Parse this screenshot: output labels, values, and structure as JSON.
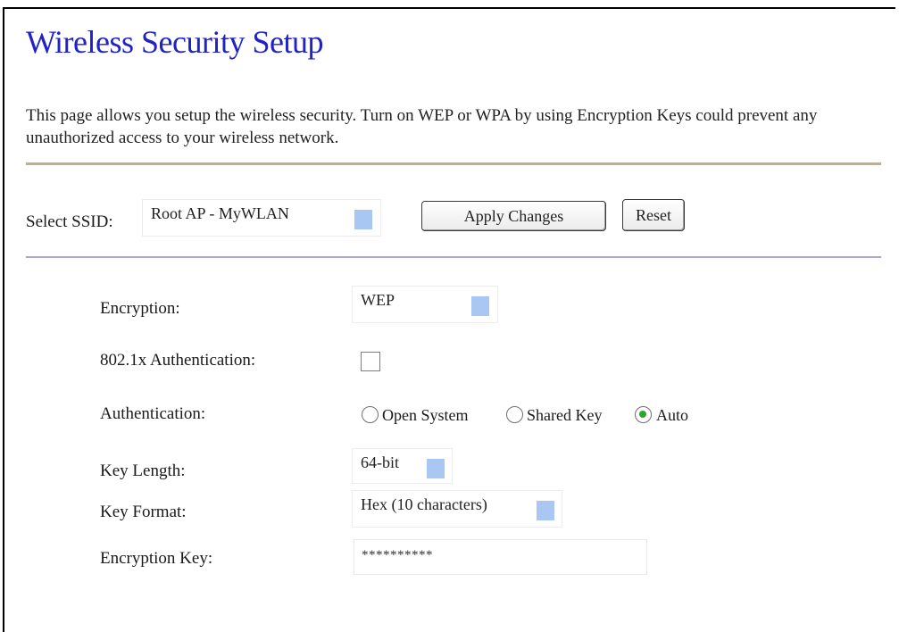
{
  "page": {
    "title": "Wireless Security Setup",
    "description": "This page allows you setup the wireless security. Turn on WEP or WPA by using Encryption Keys could prevent any unauthorized access to your wireless network."
  },
  "ssid": {
    "label": "Select SSID:",
    "selected": "Root AP - MyWLAN",
    "apply_label": "Apply Changes",
    "reset_label": "Reset"
  },
  "encryption": {
    "label": "Encryption:",
    "selected": "WEP"
  },
  "auth_8021x": {
    "label": "802.1x Authentication:",
    "checked": false
  },
  "authentication": {
    "label": "Authentication:",
    "options": [
      {
        "label": "Open System",
        "selected": false
      },
      {
        "label": "Shared Key",
        "selected": false
      },
      {
        "label": "Auto",
        "selected": true
      }
    ]
  },
  "key_length": {
    "label": "Key Length:",
    "selected": "64-bit"
  },
  "key_format": {
    "label": "Key Format:",
    "selected": "Hex (10 characters)"
  },
  "encryption_key": {
    "label": "Encryption Key:",
    "value": "**********"
  },
  "colors": {
    "title": "#1f21c9",
    "divider_tan": "#b9b19b",
    "divider_blue": "#a6a8d8",
    "select_arrow": "#a9c7f3",
    "radio_dot": "#2fa32f"
  }
}
